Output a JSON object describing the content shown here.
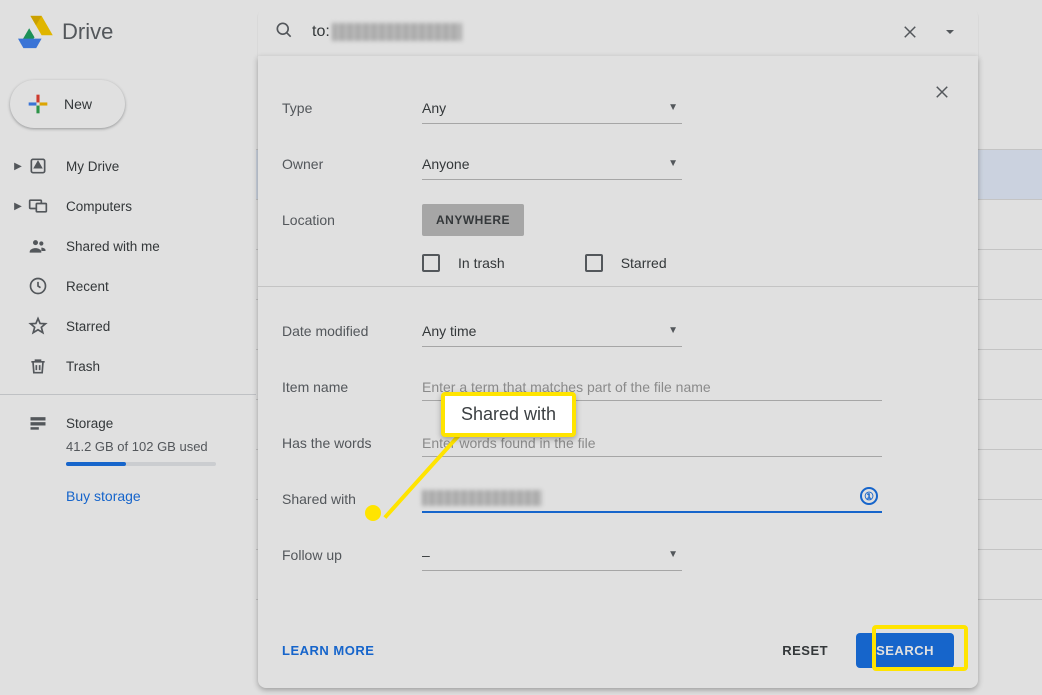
{
  "product_name": "Drive",
  "new_button_label": "New",
  "sidebar": {
    "items": [
      {
        "label": "My Drive",
        "expandable": true
      },
      {
        "label": "Computers",
        "expandable": true
      },
      {
        "label": "Shared with me",
        "expandable": false
      },
      {
        "label": "Recent",
        "expandable": false
      },
      {
        "label": "Starred",
        "expandable": false
      },
      {
        "label": "Trash",
        "expandable": false
      }
    ],
    "storage_label": "Storage",
    "storage_used_text": "41.2 GB of 102 GB used",
    "buy_storage_label": "Buy storage"
  },
  "search": {
    "query_prefix": "to:",
    "filters": {
      "type_label": "Type",
      "type_value": "Any",
      "owner_label": "Owner",
      "owner_value": "Anyone",
      "location_label": "Location",
      "location_chip": "ANYWHERE",
      "in_trash_label": "In trash",
      "starred_label": "Starred",
      "date_label": "Date modified",
      "date_value": "Any time",
      "item_name_label": "Item name",
      "item_name_placeholder": "Enter a term that matches part of the file name",
      "has_words_label": "Has the words",
      "has_words_placeholder": "Enter words found in the file",
      "shared_with_label": "Shared with",
      "follow_up_label": "Follow up",
      "follow_up_value": "–"
    },
    "learn_more_label": "LEARN MORE",
    "reset_label": "RESET",
    "search_label": "SEARCH"
  },
  "annotation": {
    "callout_text": "Shared with"
  }
}
